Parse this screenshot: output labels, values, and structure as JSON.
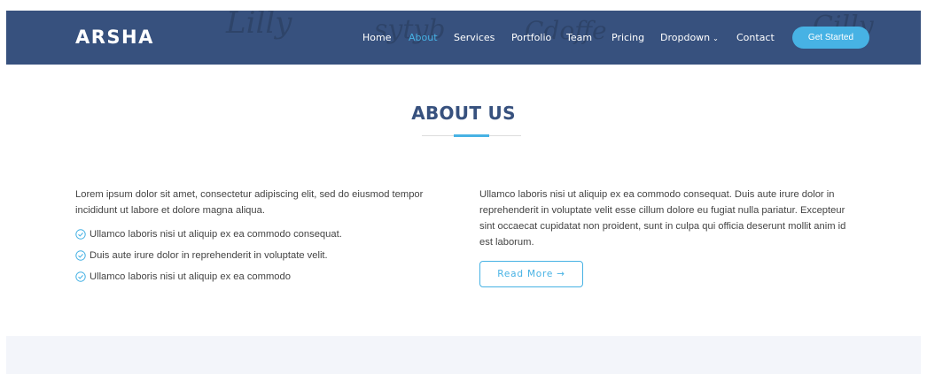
{
  "header": {
    "logo": "ARSHA",
    "watermarks": [
      "Lilly",
      "sytyb",
      "Cdoffe",
      "Cilly"
    ],
    "nav": [
      {
        "label": "Home",
        "active": false
      },
      {
        "label": "About",
        "active": true
      },
      {
        "label": "Services",
        "active": false
      },
      {
        "label": "Portfolio",
        "active": false
      },
      {
        "label": "Team",
        "active": false
      },
      {
        "label": "Pricing",
        "active": false
      },
      {
        "label": "Dropdown",
        "active": false,
        "icon": "chevron-down-icon"
      },
      {
        "label": "Contact",
        "active": false
      }
    ],
    "cta_label": "Get Started"
  },
  "about": {
    "title": "ABOUT US",
    "left_paragraph": "Lorem ipsum dolor sit amet, consectetur adipiscing elit, sed do eiusmod tempor incididunt ut labore et dolore magna aliqua.",
    "list": [
      "Ullamco laboris nisi ut aliquip ex ea commodo consequat.",
      "Duis aute irure dolor in reprehenderit in voluptate velit.",
      "Ullamco laboris nisi ut aliquip ex ea commodo"
    ],
    "right_paragraph": "Ullamco laboris nisi ut aliquip ex ea commodo consequat. Duis aute irure dolor in reprehenderit in voluptate velit esse cillum dolore eu fugiat nulla pariatur. Excepteur sint occaecat cupidatat non proident, sunt in culpa qui officia deserunt mollit anim id est laborum.",
    "read_more_label": "Read More",
    "read_more_icon": "arrow-right-icon"
  },
  "colors": {
    "header_bg": "#37517e",
    "accent": "#47b2e4",
    "text": "#444444",
    "section_alt_bg": "#f3f5fa"
  }
}
